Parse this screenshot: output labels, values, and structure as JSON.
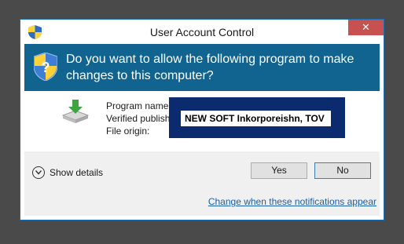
{
  "window": {
    "title": "User Account Control",
    "close_glyph": "✕"
  },
  "banner": {
    "question": "Do you want to allow the following program to make changes to this computer?"
  },
  "fields": {
    "program_name_label": "Program name",
    "verified_publisher_label": "Verified publish",
    "file_origin_label": "File origin:"
  },
  "overlay": {
    "publisher_text": "NEW SOFT Inkorporeishn, TOV"
  },
  "footer": {
    "show_details_label": "Show details",
    "yes_label": "Yes",
    "no_label": "No",
    "change_notifications_link": "Change when these notifications appear"
  },
  "icons": {
    "title_shield": "uac-shield-icon",
    "banner_shield": "uac-shield-icon",
    "program": "download-installer-icon",
    "details_toggle": "chevron-down-icon"
  },
  "colors": {
    "banner": "#10648f",
    "close_button": "#c75050",
    "overlay": "#0c2a6e",
    "link": "#1a5fa8"
  }
}
